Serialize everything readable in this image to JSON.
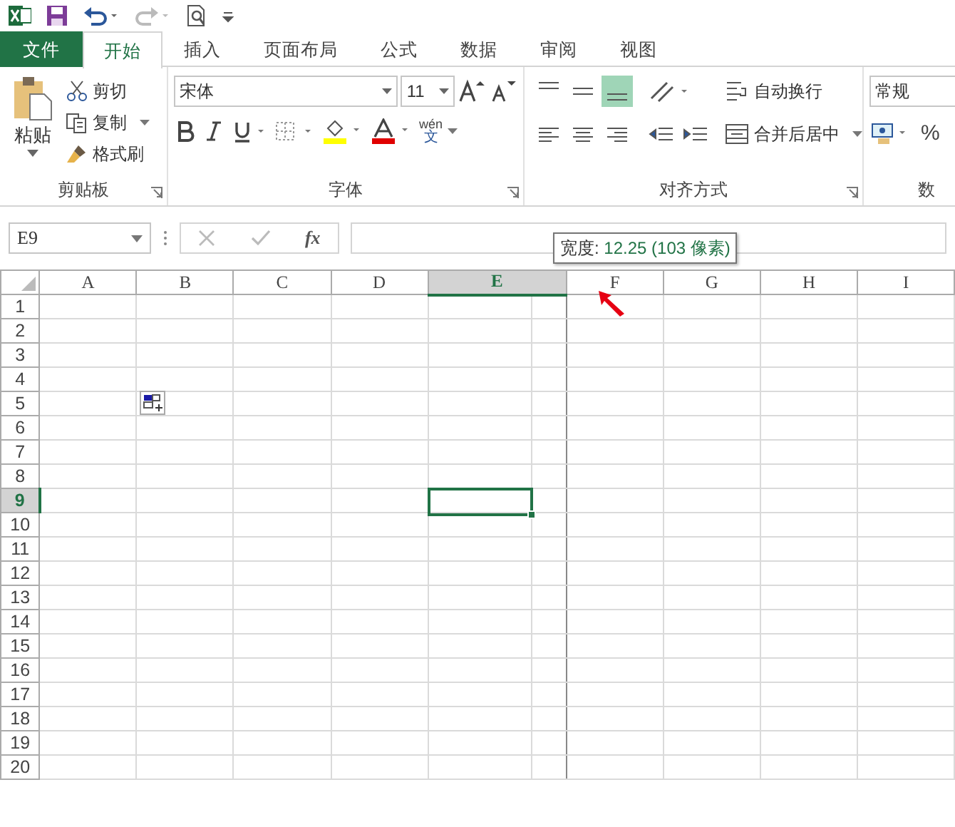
{
  "tabs": [
    {
      "label": "文件",
      "kind": "file",
      "selected": false
    },
    {
      "label": "开始",
      "kind": "tab",
      "selected": true
    },
    {
      "label": "插入",
      "kind": "tab",
      "selected": false
    },
    {
      "label": "页面布局",
      "kind": "tab",
      "selected": false
    },
    {
      "label": "公式",
      "kind": "tab",
      "selected": false
    },
    {
      "label": "数据",
      "kind": "tab",
      "selected": false
    },
    {
      "label": "审阅",
      "kind": "tab",
      "selected": false
    },
    {
      "label": "视图",
      "kind": "tab",
      "selected": false
    }
  ],
  "clipboard": {
    "paste": "粘贴",
    "items": [
      "剪切",
      "复制",
      "格式刷"
    ],
    "title": "剪贴板"
  },
  "font": {
    "font_name": "宋体",
    "font_size": "11",
    "phonetic": "wén",
    "phonetic_char": "文",
    "title": "字体"
  },
  "alignment": {
    "vertical": [
      {
        "selected": false
      },
      {
        "selected": false
      },
      {
        "selected": true
      }
    ],
    "wrap": "自动换行",
    "merge": "合并后居中",
    "title": "对齐方式"
  },
  "number": {
    "format": "常规",
    "percent": "%",
    "title": "数"
  },
  "formula_bar": {
    "name_box": "E9",
    "fx": "fx"
  },
  "tooltip": {
    "label": "宽度:",
    "value": "12.25 (103 像素)"
  },
  "columns": [
    {
      "label": "A",
      "selected": false
    },
    {
      "label": "B",
      "selected": false
    },
    {
      "label": "C",
      "selected": false
    },
    {
      "label": "D",
      "selected": false
    },
    {
      "label": "E",
      "selected": true
    },
    {
      "label": "F",
      "selected": false
    },
    {
      "label": "G",
      "selected": false
    },
    {
      "label": "H",
      "selected": false
    },
    {
      "label": "I",
      "selected": false
    }
  ],
  "rows": [
    {
      "label": "1",
      "selected": false
    },
    {
      "label": "2",
      "selected": false
    },
    {
      "label": "3",
      "selected": false
    },
    {
      "label": "4",
      "selected": false
    },
    {
      "label": "5",
      "selected": false
    },
    {
      "label": "6",
      "selected": false
    },
    {
      "label": "7",
      "selected": false
    },
    {
      "label": "8",
      "selected": false
    },
    {
      "label": "9",
      "selected": true
    },
    {
      "label": "10",
      "selected": false
    },
    {
      "label": "11",
      "selected": false
    },
    {
      "label": "12",
      "selected": false
    },
    {
      "label": "13",
      "selected": false
    },
    {
      "label": "14",
      "selected": false
    },
    {
      "label": "15",
      "selected": false
    },
    {
      "label": "16",
      "selected": false
    },
    {
      "label": "17",
      "selected": false
    },
    {
      "label": "18",
      "selected": false
    },
    {
      "label": "19",
      "selected": false
    },
    {
      "label": "20",
      "selected": false
    }
  ]
}
